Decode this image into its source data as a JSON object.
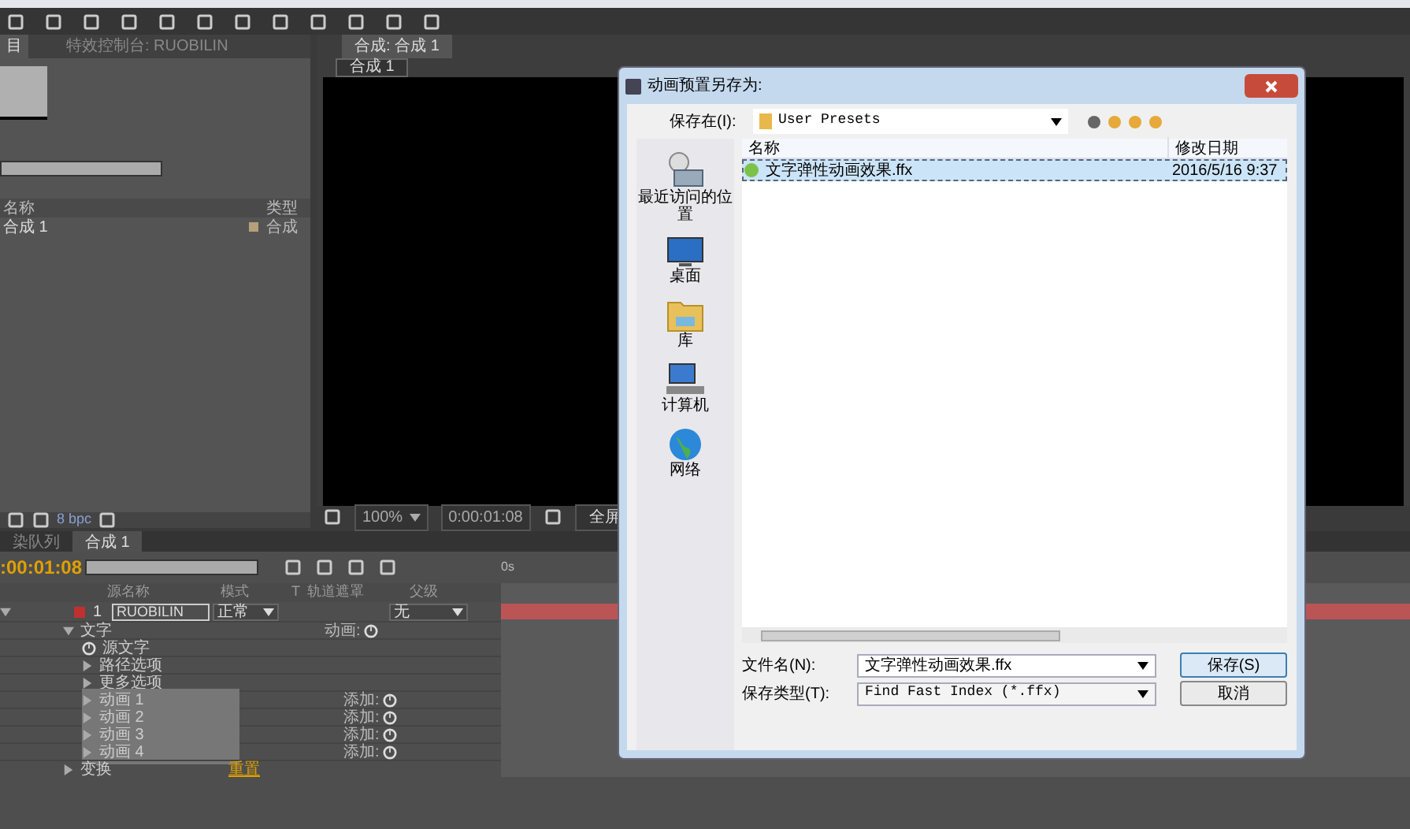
{
  "project_panel": {
    "tabs": [
      {
        "label": "目",
        "selected": true
      },
      {
        "label": "特效控制台: RUOBILIN",
        "selected": false
      }
    ],
    "columns": [
      "名称",
      "类型"
    ],
    "items": [
      {
        "name": "合成 1",
        "type": "合成",
        "color": "#b5a07a"
      }
    ],
    "bpc": "8 bpc"
  },
  "viewer": {
    "tab": "合成: 合成 1",
    "comp_button": "合成 1",
    "zoom": "100%",
    "time": "0:00:01:08",
    "view": "全屏"
  },
  "timeline": {
    "tabs": [
      {
        "label": "染队列",
        "selected": false
      },
      {
        "label": "合成 1",
        "selected": true
      }
    ],
    "time": ":00:01:08",
    "ruler": "0s",
    "columns": [
      "源名称",
      "模式",
      "T",
      "轨道遮罩",
      "父级"
    ],
    "layer": {
      "index": "1",
      "name": "RUOBILIN",
      "mode": "正常",
      "parent": "无",
      "color": "#c0302e"
    },
    "properties": [
      {
        "label": "文字",
        "expanded": true,
        "action": "动画:",
        "kind": "group",
        "children": [
          {
            "label": "源文字",
            "kind": "stopwatch"
          },
          {
            "label": "路径选项",
            "expanded": false,
            "kind": "group"
          },
          {
            "label": "更多选项",
            "expanded": false,
            "kind": "group"
          },
          {
            "label": "动画 1",
            "expanded": false,
            "kind": "animator",
            "action": "添加:"
          },
          {
            "label": "动画 2",
            "expanded": false,
            "kind": "animator",
            "action": "添加:"
          },
          {
            "label": "动画 3",
            "expanded": false,
            "kind": "animator",
            "action": "添加:"
          },
          {
            "label": "动画 4",
            "expanded": false,
            "kind": "animator",
            "action": "添加:"
          }
        ]
      },
      {
        "label": "变换",
        "expanded": false,
        "kind": "group",
        "link": "重置"
      }
    ]
  },
  "dialog": {
    "title": "动画预置另存为:",
    "save_in_label": "保存在(I):",
    "save_in": "User Presets",
    "places": [
      {
        "label": "最近访问的位置",
        "kind": "recent"
      },
      {
        "label": "桌面",
        "kind": "desktop"
      },
      {
        "label": "库",
        "kind": "library"
      },
      {
        "label": "计算机",
        "kind": "computer"
      },
      {
        "label": "网络",
        "kind": "network"
      }
    ],
    "columns": [
      "名称",
      "修改日期"
    ],
    "files": [
      {
        "name": "文字弹性动画效果.ffx",
        "modified": "2016/5/16 9:37",
        "selected": true
      }
    ],
    "filename_label": "文件名(N):",
    "filename": "文字弹性动画效果.ffx",
    "type_label": "保存类型(T):",
    "type": "Find Fast Index (*.ffx)",
    "buttons": [
      "保存(S)",
      "取消"
    ]
  }
}
